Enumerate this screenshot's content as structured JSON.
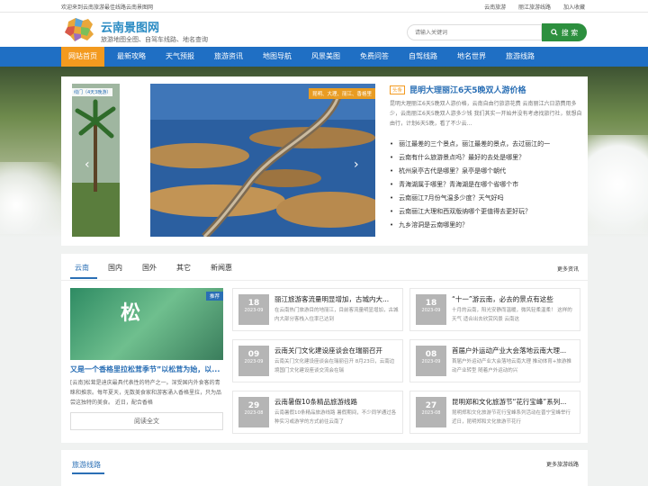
{
  "topbar": {
    "welcome": "欢迎来到云南旅游最佳线路云南景图网",
    "links": [
      "云南旅游",
      "丽江旅游线路",
      "加入收藏"
    ]
  },
  "header": {
    "title": "云南景图网",
    "slogan": "旅游地图全图、自驾车线路、地名查询",
    "search_placeholder": "请输入关键词",
    "search_button": "搜 索"
  },
  "nav": {
    "items": [
      "网站首页",
      "最新攻略",
      "天气预报",
      "旅游资讯",
      "地图导航",
      "风景美图",
      "免费问答",
      "自驾线路",
      "地名世界",
      "旅游线路"
    ]
  },
  "focus": {
    "left_thumb_tag": "线门（4天3晚游）",
    "slide_tag": "昆明、大理、丽江、香格里",
    "headline_tag": "头条",
    "headline": "昆明大理丽江6天5晚双人游价格",
    "headline_desc": "昆明大理丽江6天5晚双人游价格，云南自由行旅游花费 云南丽江六日游费用多少，云南丽江6天5晚双人游多少钱 我们其实一开始并没有考虑找旅行社，就想自由行，计划6天5晚，看了不少云...",
    "news": [
      "丽江最差的三个景点，丽江最差的景点，去过丽江的一",
      "云南有什么旅游景点吗？最好的去处是哪里？",
      "杭州泉亭古代是哪里？泉亭是哪个朝代",
      "青海湖属于哪里？青海湖是在哪个省哪个市",
      "云南丽江7月份气温多少度？天气好吗",
      "云南丽江大理和西双版纳哪个更值得去更好玩？",
      "九乡溶洞是云南哪里的？"
    ]
  },
  "news_tabs": {
    "tabs": [
      "云南",
      "国内",
      "国外",
      "其它",
      "新闻惠"
    ],
    "more": "更多资讯",
    "feature": {
      "tag": "推荐",
      "image_text": "松",
      "title": "又是一个香格里拉松茸季节”以松茸为始，以...",
      "desc": "[云南]松茸是迪庆最具代表性的特产之一。深受国内外食客的青睐和推崇。每年夏天，无数美食家和游客涌入香格里拉，只为品尝这独特的美食。 近日，配合香格",
      "read_more": "阅读全文"
    },
    "cards": [
      {
        "day": "18",
        "ym": "2023-09",
        "title": "丽江旅游客流量明显增加，古城内大...",
        "desc": "在云南热门旅游目的地丽江，目前客流量明显增加，古城内大部分客栈入住率已达到"
      },
      {
        "day": "18",
        "ym": "2023-09",
        "title": "“十一”游云南，必去的景点有这些",
        "desc": "十月的云南，阳光安静而温暖，微风轻柔温柔！ 这样的天气 适合出去欣赏风景 云南这"
      },
      {
        "day": "09",
        "ym": "2023-09",
        "title": "云南关门文化建设座谈会在瑞丽召开",
        "desc": "云南关门文化建设座谈会在瑞丽召开 8月23日，云南边境国门文化建设座谈交流会在瑞"
      },
      {
        "day": "08",
        "ym": "2023-09",
        "title": "首届户外运动产业大会落地云南大理...",
        "desc": "首届户外运动产业大会落地云南大理 推动体育+旅游推动产业转型 随着户外运动的兴"
      },
      {
        "day": "29",
        "ym": "2023-08",
        "title": "云南暑假10条精品旅游线路",
        "desc": "云南暑假10条精品旅游线路 暑假期间，不少同学通过各种实习或游学的方式前往云南了"
      },
      {
        "day": "27",
        "ym": "2023-08",
        "title": "昆明郑和文化旅游节“花行宝峰”系列...",
        "desc": "昆明郑和文化旅游节花行宝峰系列活动在晋宁宝峰举行 近日，昆明郑和文化旅游节花行"
      }
    ]
  },
  "routes": {
    "title": "旅游线路",
    "more": "更多旅游线路"
  },
  "colors": {
    "brand_blue": "#1f6fc4",
    "nav_active": "#f39a1f",
    "search_green": "#2c8f3e"
  }
}
